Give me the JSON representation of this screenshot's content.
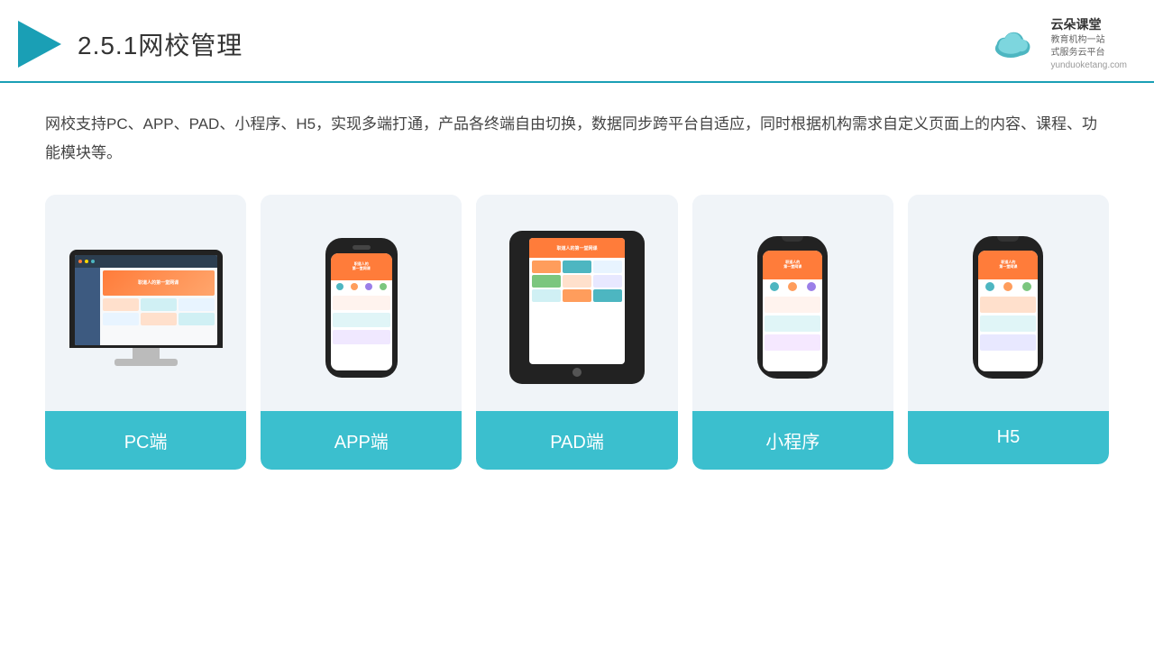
{
  "header": {
    "title_prefix": "2.5.1",
    "title_main": "网校管理",
    "logo_name": "云朵课堂",
    "logo_subtitle": "教育机构一站\n式服务云平台",
    "logo_url": "yunduoketang.com"
  },
  "description": {
    "text": "网校支持PC、APP、PAD、小程序、H5，实现多端打通，产品各终端自由切换，数据同步跨平台自适应，同时根据机构需求自定义页面上的内容、课程、功能模块等。"
  },
  "cards": [
    {
      "id": "pc",
      "label": "PC端"
    },
    {
      "id": "app",
      "label": "APP端"
    },
    {
      "id": "pad",
      "label": "PAD端"
    },
    {
      "id": "miniprogram",
      "label": "小程序"
    },
    {
      "id": "h5",
      "label": "H5"
    }
  ],
  "colors": {
    "accent": "#3bbfce",
    "divider": "#1a9fb5",
    "card_bg": "#eef2f7",
    "label_bg": "#3bbfce",
    "label_text": "#ffffff"
  }
}
